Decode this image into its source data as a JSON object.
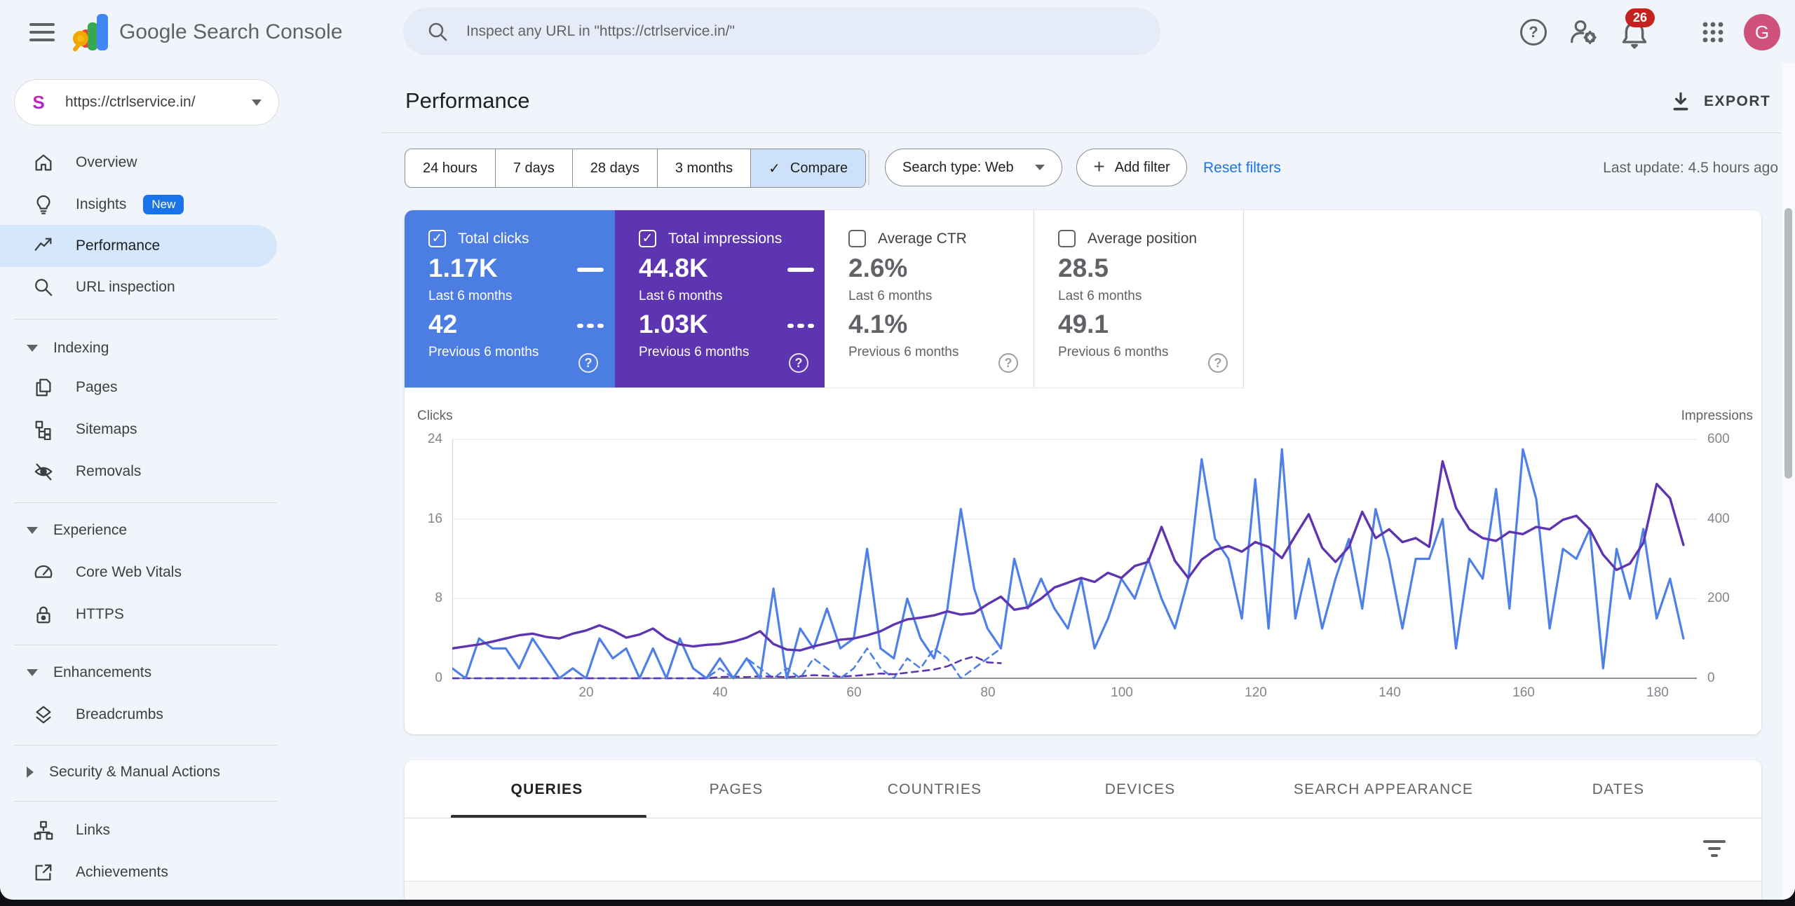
{
  "topbar": {
    "app_title": "Google Search Console",
    "search_placeholder": "Inspect any URL in \"https://ctrlservice.in/\"",
    "notification_count": "26",
    "avatar_letter": "G",
    "help_glyph": "?"
  },
  "sidebar": {
    "property_url": "https://ctrlservice.in/",
    "favicon_letter": "S",
    "overview": "Overview",
    "insights": "Insights",
    "insights_badge": "New",
    "performance": "Performance",
    "url_inspection": "URL inspection",
    "indexing": "Indexing",
    "pages": "Pages",
    "sitemaps": "Sitemaps",
    "removals": "Removals",
    "experience": "Experience",
    "core_web_vitals": "Core Web Vitals",
    "https": "HTTPS",
    "enhancements": "Enhancements",
    "breadcrumbs": "Breadcrumbs",
    "security": "Security & Manual Actions",
    "links": "Links",
    "achievements": "Achievements"
  },
  "header": {
    "title": "Performance",
    "export_label": "EXPORT"
  },
  "filters": {
    "range_chips": [
      "24 hours",
      "7 days",
      "28 days",
      "3 months"
    ],
    "compare": "Compare",
    "compare_check": "✓",
    "search_type": "Search type: Web",
    "add_filter": "Add filter",
    "add_plus": "+",
    "reset": "Reset filters",
    "last_update": "Last update: 4.5 hours ago"
  },
  "cards": [
    {
      "label": "Total clicks",
      "checked": true,
      "check_glyph": "✓",
      "value_last": "1.17K",
      "period_last": "Last 6 months",
      "value_prev": "42",
      "period_prev": "Previous 6 months",
      "color": "#4c7de2",
      "help_glyph": "?"
    },
    {
      "label": "Total impressions",
      "checked": true,
      "check_glyph": "✓",
      "value_last": "44.8K",
      "period_last": "Last 6 months",
      "value_prev": "1.03K",
      "period_prev": "Previous 6 months",
      "color": "#5e35b1",
      "help_glyph": "?"
    },
    {
      "label": "Average CTR",
      "checked": false,
      "value_last": "2.6%",
      "period_last": "Last 6 months",
      "value_prev": "4.1%",
      "period_prev": "Previous 6 months",
      "color": "#ffffff",
      "help_glyph": "?"
    },
    {
      "label": "Average position",
      "checked": false,
      "value_last": "28.5",
      "period_last": "Last 6 months",
      "value_prev": "49.1",
      "period_prev": "Previous 6 months",
      "color": "#ffffff",
      "help_glyph": "?"
    }
  ],
  "chart_data": {
    "type": "line",
    "x_axis": "days (index over last 6 months)",
    "x_max": 186,
    "x_ticks": [
      20,
      40,
      60,
      80,
      100,
      120,
      140,
      160,
      180
    ],
    "y_left": {
      "label": "Clicks",
      "ticks": [
        24,
        16,
        8,
        0
      ],
      "max": 24
    },
    "y_right": {
      "label": "Impressions",
      "ticks": [
        600,
        400,
        200,
        0
      ],
      "max": 600
    },
    "grid": true,
    "legend_position": "in metric cards",
    "series": [
      {
        "name": "Total clicks — Last 6 months",
        "axis": "left",
        "style": "solid",
        "color": "#4f80e8",
        "x_step": 2,
        "values": [
          1,
          0,
          4,
          3,
          3,
          1,
          4,
          2,
          0,
          1,
          0,
          4,
          2,
          3,
          0,
          3,
          0,
          4,
          1,
          0,
          2,
          0,
          2,
          0,
          9,
          0,
          5,
          3,
          7,
          3,
          4,
          13,
          3,
          2,
          8,
          4,
          2,
          7,
          17,
          9,
          5,
          3,
          12,
          7,
          10,
          7,
          5,
          10,
          3,
          6,
          10,
          8,
          12,
          8,
          5,
          10,
          22,
          14,
          12,
          6,
          20,
          5,
          23,
          6,
          12,
          5,
          10,
          14,
          7,
          17,
          12,
          5,
          12,
          12,
          16,
          3,
          12,
          10,
          19,
          7,
          23,
          18,
          5,
          13,
          12,
          15,
          1,
          13,
          8,
          15,
          6,
          10,
          4
        ]
      },
      {
        "name": "Total impressions — Last 6 months",
        "axis": "right",
        "style": "solid",
        "color": "#5e35b1",
        "x_step": 2,
        "values": [
          75,
          80,
          85,
          92,
          100,
          108,
          112,
          104,
          100,
          112,
          120,
          133,
          120,
          102,
          110,
          125,
          100,
          85,
          80,
          84,
          86,
          92,
          102,
          118,
          86,
          72,
          70,
          80,
          88,
          97,
          100,
          108,
          118,
          135,
          148,
          152,
          158,
          168,
          160,
          164,
          186,
          205,
          172,
          178,
          200,
          228,
          240,
          252,
          242,
          265,
          252,
          282,
          292,
          380,
          295,
          252,
          298,
          322,
          332,
          318,
          342,
          330,
          302,
          358,
          412,
          328,
          292,
          330,
          418,
          352,
          374,
          342,
          352,
          330,
          545,
          428,
          374,
          352,
          345,
          368,
          362,
          380,
          374,
          398,
          408,
          374,
          310,
          272,
          288,
          340,
          488,
          452,
          335
        ]
      },
      {
        "name": "Total clicks — Previous 6 months",
        "axis": "left",
        "style": "dashed",
        "color": "#4f80e8",
        "x_step": 2,
        "values": [
          0,
          0,
          0,
          0,
          0,
          0,
          0,
          0,
          0,
          0,
          0,
          0,
          0,
          0,
          0,
          0,
          0,
          0,
          0,
          0,
          1,
          0,
          2,
          1,
          0,
          1,
          0,
          2,
          1,
          0,
          1,
          3,
          1,
          0,
          2,
          1,
          3,
          2,
          0,
          1,
          2,
          3
        ]
      },
      {
        "name": "Total impressions — Previous 6 months",
        "axis": "right",
        "style": "dashed",
        "color": "#5e35b1",
        "x_step": 2,
        "values": [
          0,
          0,
          0,
          0,
          0,
          0,
          0,
          0,
          0,
          0,
          0,
          0,
          0,
          0,
          0,
          0,
          0,
          0,
          0,
          0,
          3,
          4,
          3,
          5,
          4,
          3,
          5,
          8,
          6,
          4,
          6,
          9,
          12,
          10,
          14,
          18,
          22,
          30,
          45,
          55,
          40,
          38
        ]
      }
    ]
  },
  "tabs": {
    "items": [
      "QUERIES",
      "PAGES",
      "COUNTRIES",
      "DEVICES",
      "SEARCH APPEARANCE",
      "DATES"
    ],
    "active": "QUERIES"
  },
  "colors": {
    "clicks_blue": "#4c7de2",
    "impressions_purple": "#5e35b1",
    "selected_nav_bg": "#d5e7fb",
    "link_blue": "#1a73e8",
    "badge_red": "#c5221f",
    "page_bg": "#f1f4fa"
  }
}
